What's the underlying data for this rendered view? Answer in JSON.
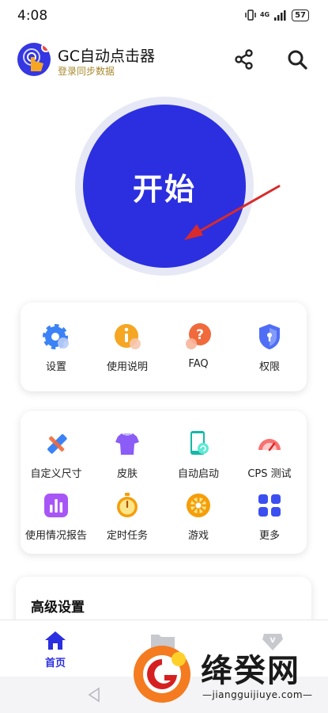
{
  "status_bar": {
    "time": "4:08",
    "network": "4G",
    "battery": "57"
  },
  "app_bar": {
    "title": "GC自动点击器",
    "subtitle": "登录同步数据",
    "share_icon": "share-icon",
    "search_icon": "search-icon"
  },
  "start": {
    "label": "开始"
  },
  "colors": {
    "primary": "#2b2fdf",
    "subtitle": "#a88a2e",
    "logo_dot": "#f0443a"
  },
  "card1": {
    "items": [
      {
        "label": "设置",
        "icon": "gear-icon"
      },
      {
        "label": "使用说明",
        "icon": "info-icon"
      },
      {
        "label": "FAQ",
        "icon": "question-icon"
      },
      {
        "label": "权限",
        "icon": "shield-icon"
      }
    ]
  },
  "card2": {
    "items": [
      {
        "label": "自定义尺寸",
        "icon": "ruler-pencil-icon"
      },
      {
        "label": "皮肤",
        "icon": "tshirt-icon"
      },
      {
        "label": "自动启动",
        "icon": "phone-sync-icon"
      },
      {
        "label": "CPS 测试",
        "icon": "speedometer-icon"
      },
      {
        "label": "使用情况报告",
        "icon": "bar-chart-icon"
      },
      {
        "label": "定时任务",
        "icon": "stopwatch-icon"
      },
      {
        "label": "游戏",
        "icon": "game-wheel-icon"
      },
      {
        "label": "更多",
        "icon": "grid-icon"
      }
    ]
  },
  "advanced": {
    "title": "高级设置"
  },
  "bottom_nav": {
    "home_label": "首页"
  },
  "watermark": {
    "brand": "绛癸网",
    "url": "—jiangguijiuye.com—"
  }
}
